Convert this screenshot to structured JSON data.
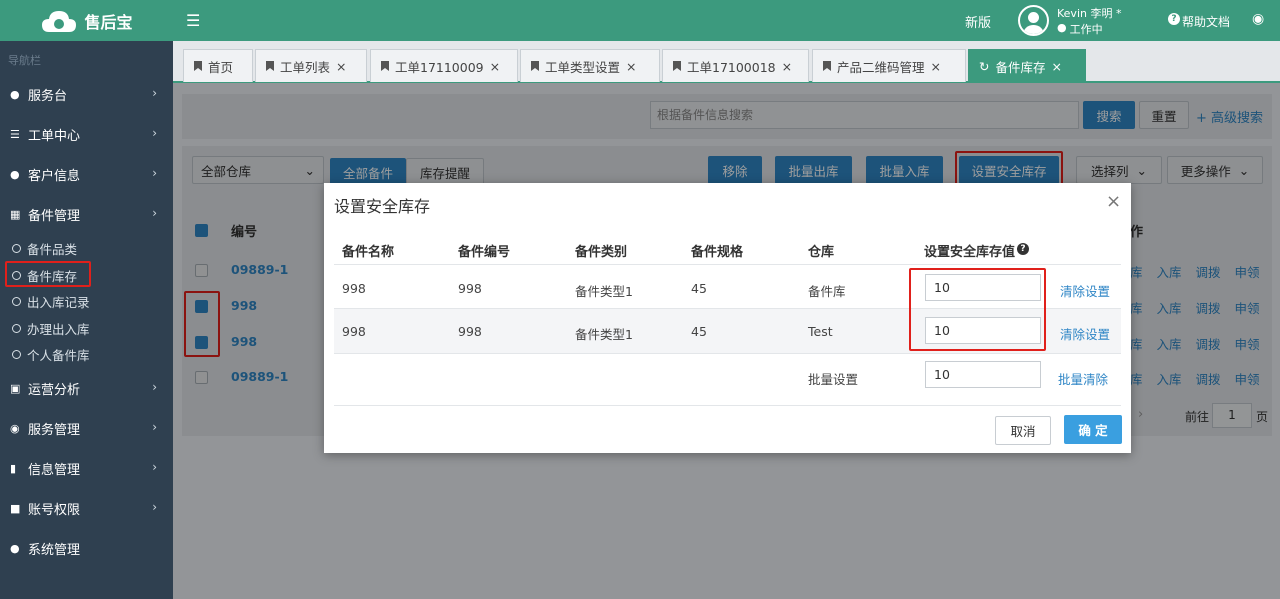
{
  "app": {
    "brand": "售后宝"
  },
  "sidebar": {
    "nav_label": "导航栏",
    "items": [
      {
        "label": "服务台",
        "icon": "user-icon"
      },
      {
        "label": "工单中心",
        "icon": "workorder-icon"
      },
      {
        "label": "客户信息",
        "icon": "customer-icon"
      },
      {
        "label": "备件管理",
        "icon": "grid-icon"
      }
    ],
    "sub_items": [
      "备件品类",
      "备件库存",
      "出入库记录",
      "办理出入库",
      "个人备件库"
    ],
    "items_bottom": [
      {
        "label": "运营分析",
        "icon": "bar-chart-icon"
      },
      {
        "label": "服务管理",
        "icon": "service-icon"
      },
      {
        "label": "信息管理",
        "icon": "book-icon"
      },
      {
        "label": "账号权限",
        "icon": "lock-icon"
      },
      {
        "label": "系统管理",
        "icon": "users-icon"
      }
    ]
  },
  "topbar": {
    "menu_icon": "hamburger-icon",
    "new_version": "新版",
    "user_name": "Kevin 李明 *",
    "user_status": "工作中",
    "help": "帮助文档"
  },
  "tabs": [
    {
      "label": "首页",
      "closable": false
    },
    {
      "label": "工单列表",
      "closable": true
    },
    {
      "label": "工单17110009",
      "closable": true
    },
    {
      "label": "工单类型设置",
      "closable": true
    },
    {
      "label": "工单17100018",
      "closable": true
    },
    {
      "label": "产品二维码管理",
      "closable": true
    },
    {
      "label": "备件库存",
      "closable": true,
      "active": true
    }
  ],
  "search": {
    "placeholder": "根据备件信息搜索",
    "search_btn": "搜索",
    "reset_btn": "重置",
    "advanced": "+ 高级搜索"
  },
  "toolbar": {
    "warehouse_select": "全部仓库",
    "view_all": "全部备件",
    "view_alert": "库存提醒",
    "remove": "移除",
    "batch_out": "批量出库",
    "batch_in": "批量入库",
    "set_safe": "设置安全库存",
    "select_cols": "选择列",
    "more_ops": "更多操作"
  },
  "bg_table": {
    "col_no": "编号",
    "col_ops": "作",
    "rows": [
      {
        "no": "09889-1",
        "checked": false
      },
      {
        "no": "998",
        "checked": true
      },
      {
        "no": "998",
        "checked": true
      },
      {
        "no": "09889-1",
        "checked": false
      }
    ],
    "row_actions": [
      "库",
      "入库",
      "调拨",
      "申领"
    ],
    "pagination": {
      "goto": "前往",
      "page": "1",
      "suffix": "页"
    }
  },
  "modal": {
    "title": "设置安全库存",
    "headers": [
      "备件名称",
      "备件编号",
      "备件类别",
      "备件规格",
      "仓库",
      "设置安全库存值"
    ],
    "rows": [
      {
        "name": "998",
        "code": "998",
        "category": "备件类型1",
        "spec": "45",
        "warehouse": "备件库",
        "value": "10",
        "clear": "清除设置"
      },
      {
        "name": "998",
        "code": "998",
        "category": "备件类型1",
        "spec": "45",
        "warehouse": "Test",
        "value": "10",
        "clear": "清除设置"
      }
    ],
    "batch": {
      "label": "批量设置",
      "value": "10",
      "clear": "批量清除"
    },
    "cancel": "取消",
    "confirm": "确 定"
  },
  "colors": {
    "primary": "#3c9a7e",
    "sidebar": "#2f4050",
    "blue": "#2f86c6",
    "highlight": "#e0201b"
  }
}
